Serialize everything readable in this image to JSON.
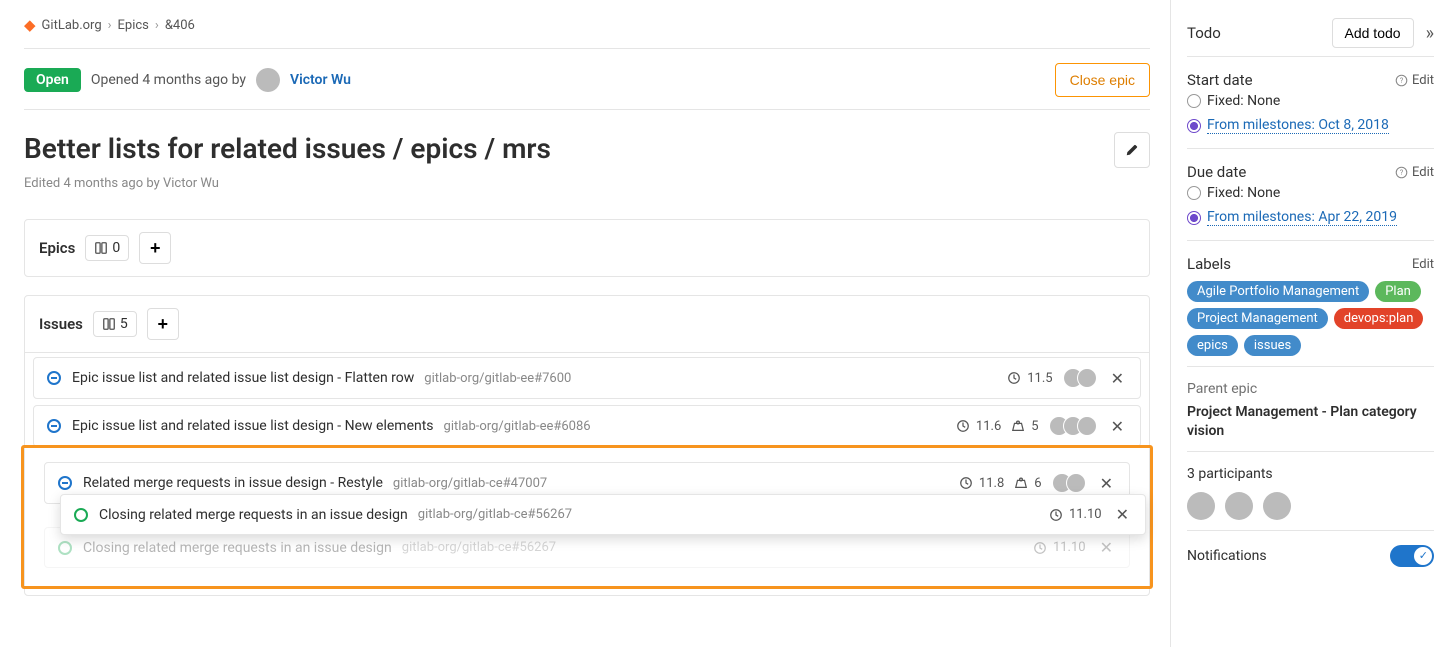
{
  "breadcrumbs": {
    "org": "GitLab.org",
    "section": "Epics",
    "id": "&406"
  },
  "state_badge": "Open",
  "opened_text": "Opened 4 months ago by",
  "author": "Victor Wu",
  "close_button": "Close epic",
  "title": "Better lists for related issues / epics / mrs",
  "edited_text": "Edited 4 months ago by Victor Wu",
  "epics_panel": {
    "label": "Epics",
    "count": "0"
  },
  "issues_panel": {
    "label": "Issues",
    "count": "5"
  },
  "issues": [
    {
      "title": "Epic issue list and related issue list design - Flatten row",
      "ref": "gitlab-org/gitlab-ee#7600",
      "milestone": "11.5",
      "weight": "",
      "avatars": 2,
      "status": "closed"
    },
    {
      "title": "Epic issue list and related issue list design - New elements",
      "ref": "gitlab-org/gitlab-ee#6086",
      "milestone": "11.6",
      "weight": "5",
      "avatars": 3,
      "status": "closed"
    },
    {
      "title": "Related merge requests in issue design - Restyle",
      "ref": "gitlab-org/gitlab-ce#47007",
      "milestone": "11.8",
      "weight": "6",
      "avatars": 2,
      "status": "closed"
    },
    {
      "title": "Closing related merge requests in an issue design",
      "ref": "gitlab-org/gitlab-ce#56267",
      "milestone": "11.10",
      "weight": "",
      "avatars": 0,
      "status": "open"
    },
    {
      "title": "Closing related merge requests in an issue design",
      "ref": "gitlab-org/gitlab-ce#56267",
      "milestone": "11.10",
      "weight": "",
      "avatars": 0,
      "status": "open"
    }
  ],
  "sidebar": {
    "todo_label": "Todo",
    "add_todo": "Add todo",
    "start_date": {
      "title": "Start date",
      "edit": "Edit",
      "fixed": "Fixed: None",
      "ms_prefix": "From milestones:",
      "ms_value": "Oct 8, 2018"
    },
    "due_date": {
      "title": "Due date",
      "edit": "Edit",
      "fixed": "Fixed: None",
      "ms_prefix": "From milestones:",
      "ms_value": "Apr 22, 2019"
    },
    "labels_title": "Labels",
    "labels_edit": "Edit",
    "labels": [
      {
        "text": "Agile Portfolio Management",
        "color": "#428bca"
      },
      {
        "text": "Plan",
        "color": "#5cb85c"
      },
      {
        "text": "Project Management",
        "color": "#428bca"
      },
      {
        "text": "devops:plan",
        "color": "#e24329"
      },
      {
        "text": "epics",
        "color": "#428bca"
      },
      {
        "text": "issues",
        "color": "#428bca"
      }
    ],
    "parent_title": "Parent epic",
    "parent_name": "Project Management - Plan category vision",
    "participants_text": "3 participants",
    "notifications": "Notifications"
  }
}
